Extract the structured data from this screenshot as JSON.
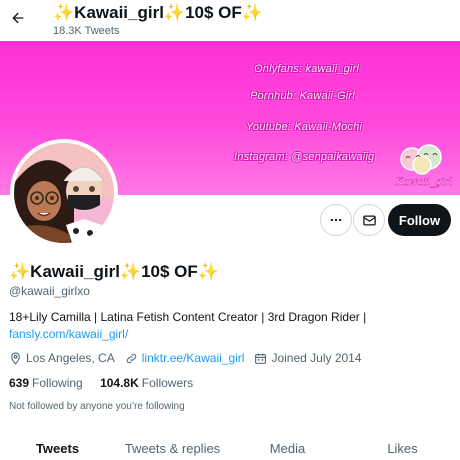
{
  "header": {
    "title": "✨Kawaii_girl✨10$ OF✨",
    "subtitle": "18.3K Tweets",
    "back_icon": "arrow-left-icon"
  },
  "banner": {
    "lines": [
      "Onlyfans: kawaii_girl",
      "Pornhub: Kawaii-Girl",
      "Youtube: Kawaii-Mochi",
      "Instagram: @senpaikawaiig"
    ],
    "logo_text": "Kawaii_girl",
    "colors": {
      "top": "#ff2fd8",
      "bottom": "#ff7ae6",
      "outline": "#d10fb0"
    }
  },
  "profile": {
    "display_name": "✨Kawaii_girl✨10$ OF✨",
    "handle": "@kawaii_girlxo",
    "bio": "18+Lily Camilla | Latina Fetish Content Creator | 3rd Dragon Rider |",
    "bio_link": "fansly.com/kawaii_girl/",
    "location": "Los Angeles, CA",
    "website": "linktr.ee/Kawaii_girl",
    "joined": "Joined July 2014",
    "following_count": "639",
    "following_label": "Following",
    "followers_count": "104.8K",
    "followers_label": "Followers",
    "not_followed": "Not followed by anyone you’re following"
  },
  "actions": {
    "more_icon": "more-icon",
    "message_icon": "envelope-icon",
    "follow_label": "Follow"
  },
  "tabs": [
    {
      "label": "Tweets",
      "active": true
    },
    {
      "label": "Tweets & replies",
      "active": false
    },
    {
      "label": "Media",
      "active": false
    },
    {
      "label": "Likes",
      "active": false
    }
  ],
  "colors": {
    "text": "#0f1419",
    "secondary": "#536471",
    "link": "#1d9bf0",
    "follow_bg": "#0f1419"
  }
}
